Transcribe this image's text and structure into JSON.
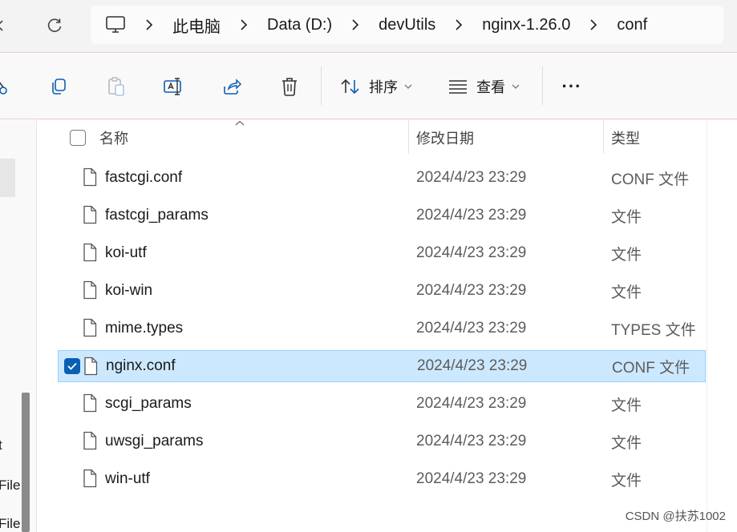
{
  "address_bar": {
    "breadcrumbs": [
      "此电脑",
      "Data (D:)",
      "devUtils",
      "nginx-1.26.0",
      "conf"
    ]
  },
  "toolbar": {
    "sort_label": "排序",
    "view_label": "查看",
    "more_label": "···"
  },
  "navpane": {
    "partial_labels": [
      "t",
      "File",
      "File"
    ]
  },
  "columns": {
    "name": "名称",
    "date": "修改日期",
    "type": "类型"
  },
  "files": [
    {
      "name": "fastcgi.conf",
      "date": "2024/4/23 23:29",
      "type": "CONF 文件",
      "selected": false
    },
    {
      "name": "fastcgi_params",
      "date": "2024/4/23 23:29",
      "type": "文件",
      "selected": false
    },
    {
      "name": "koi-utf",
      "date": "2024/4/23 23:29",
      "type": "文件",
      "selected": false
    },
    {
      "name": "koi-win",
      "date": "2024/4/23 23:29",
      "type": "文件",
      "selected": false
    },
    {
      "name": "mime.types",
      "date": "2024/4/23 23:29",
      "type": "TYPES 文件",
      "selected": false
    },
    {
      "name": "nginx.conf",
      "date": "2024/4/23 23:29",
      "type": "CONF 文件",
      "selected": true
    },
    {
      "name": "scgi_params",
      "date": "2024/4/23 23:29",
      "type": "文件",
      "selected": false
    },
    {
      "name": "uwsgi_params",
      "date": "2024/4/23 23:29",
      "type": "文件",
      "selected": false
    },
    {
      "name": "win-utf",
      "date": "2024/4/23 23:29",
      "type": "文件",
      "selected": false
    }
  ],
  "watermark": "CSDN @扶苏1002",
  "colors": {
    "selection_bg": "#cce8ff",
    "selection_border": "#99d1ff",
    "checkbox_accent": "#0a5fb4"
  }
}
